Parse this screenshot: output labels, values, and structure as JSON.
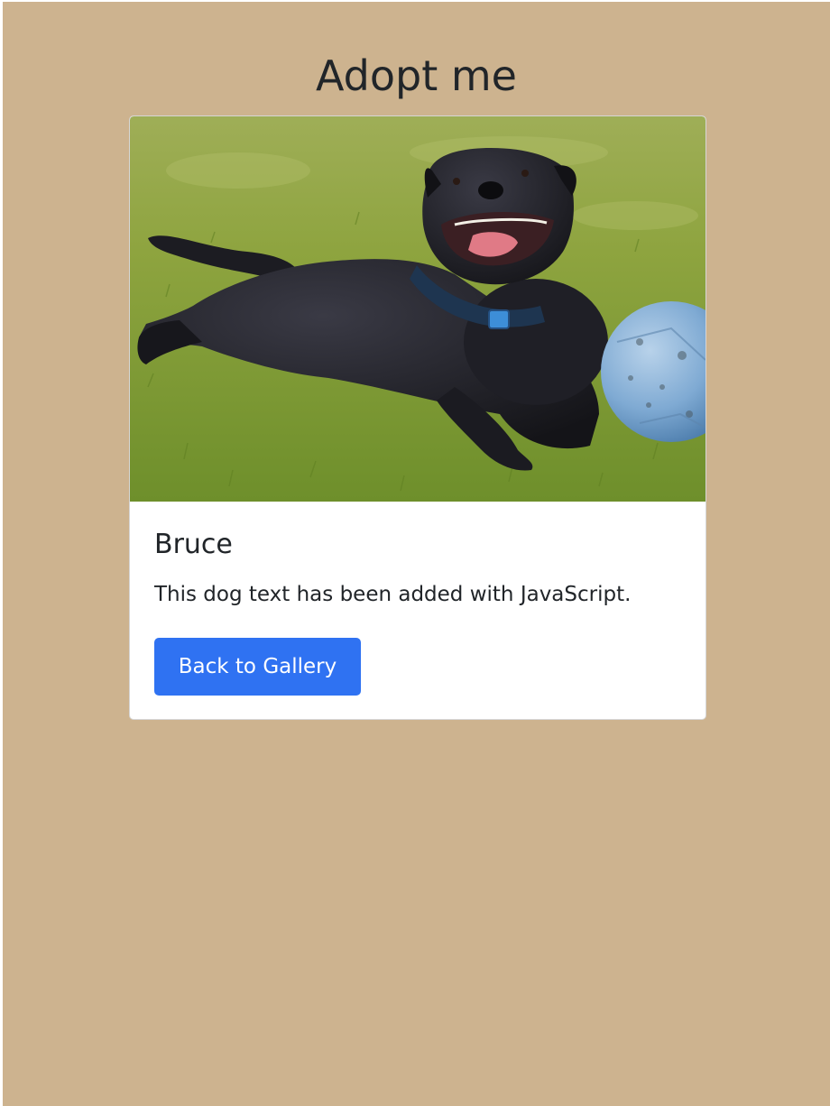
{
  "page": {
    "title": "Adopt me",
    "background_color": "#cdb38f"
  },
  "card": {
    "image_alt": "dog-photo",
    "name": "Bruce",
    "description": "This dog text has been added with JavaScript.",
    "button_label": "Back to Gallery",
    "button_color": "#2f72f2"
  }
}
